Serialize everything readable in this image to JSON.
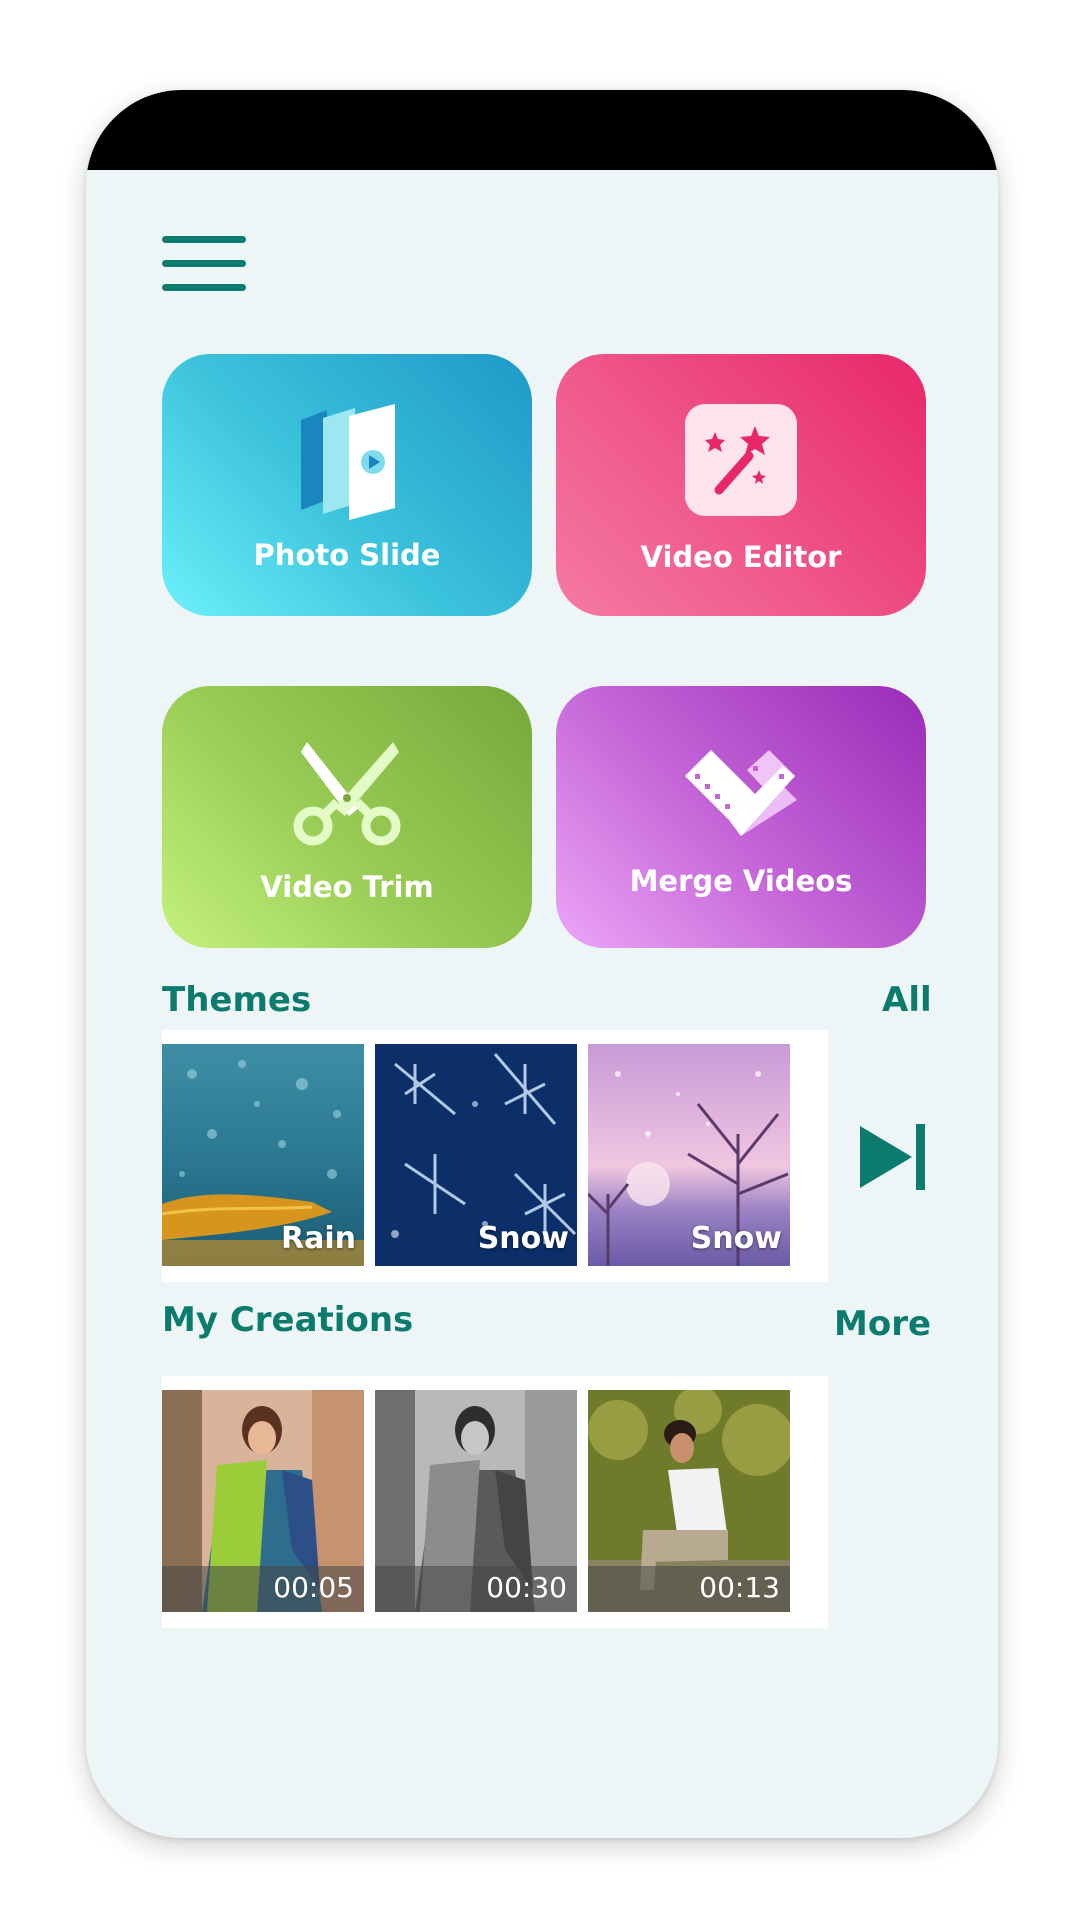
{
  "tiles": {
    "photo_slide": "Photo Slide",
    "video_editor": "Video Editor",
    "video_trim": "Video Trim",
    "merge_videos": "Merge Videos"
  },
  "themes": {
    "title": "Themes",
    "link": "All",
    "items": [
      {
        "label": "Rain"
      },
      {
        "label": "Snow"
      },
      {
        "label": "Snow"
      }
    ]
  },
  "creations": {
    "title": "My Creations",
    "link": "More",
    "items": [
      {
        "duration": "00:05"
      },
      {
        "duration": "00:30"
      },
      {
        "duration": "00:13"
      }
    ]
  },
  "colors": {
    "accent": "#0b7b6e",
    "background": "#eef5f7",
    "photo_slide": "#3cc3dc",
    "video_editor": "#f05a8c",
    "video_trim": "#99cc55",
    "merge_videos": "#c566d8"
  },
  "icons": {
    "menu": "hamburger-menu-icon",
    "photo_slide": "slides-icon",
    "video_editor": "magic-wand-icon",
    "video_trim": "scissors-icon",
    "merge_videos": "film-heart-icon",
    "next": "skip-next-icon"
  }
}
